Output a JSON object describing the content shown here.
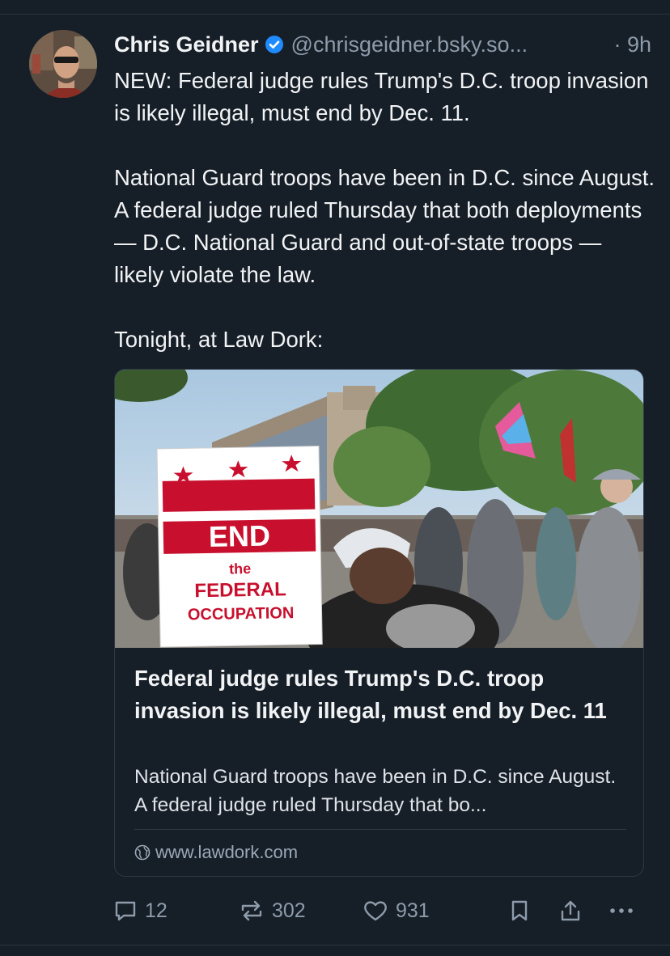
{
  "post": {
    "author": {
      "name": "Chris Geidner",
      "handle": "@chrisgeidner.bsky.so...",
      "verified": true,
      "avatar_icon": "profile-photo"
    },
    "time": "· 9h",
    "paragraphs": [
      "NEW: Federal judge rules Trump's D.C. troop invasion is likely illegal, must end by Dec. 11.",
      "National Guard troops have been in D.C. since August. A federal judge ruled Thursday that both deployments — D.C. National Guard and out-of-state troops — likely violate the law.",
      "Tonight, at Law Dork:"
    ]
  },
  "card": {
    "image": {
      "sign_lines": [
        "END",
        "the",
        "FEDERAL",
        "OCCUPATION"
      ]
    },
    "title": "Federal judge rules Trump's D.C. troop invasion is likely illegal, must end by Dec. 11",
    "description": "National Guard troops have been in D.C. since August. A federal judge ruled Thursday that bo...",
    "domain": "www.lawdork.com"
  },
  "actions": {
    "replies": "12",
    "reposts": "302",
    "likes": "931"
  },
  "colors": {
    "background": "#161e27",
    "text": "#f1f3f5",
    "muted": "#8d9bab",
    "verified": "#208bfe"
  }
}
